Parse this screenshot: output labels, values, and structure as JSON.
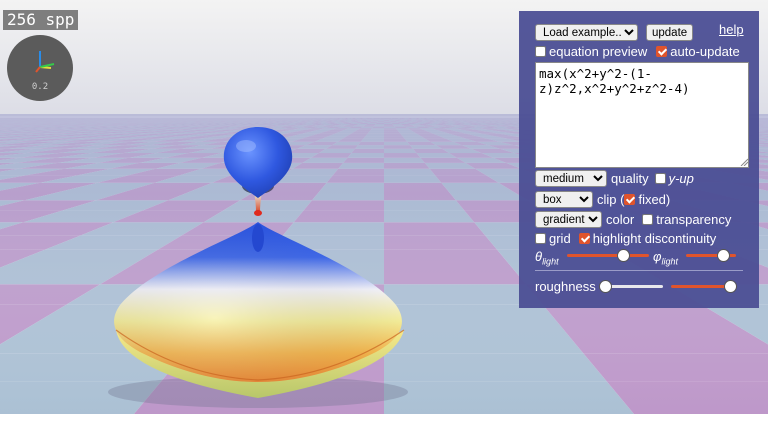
{
  "hud": {
    "spp": "256 spp",
    "gizmo_value": "0.2"
  },
  "panel": {
    "load_example": "Load example...",
    "update": "update",
    "help": "help",
    "equation_preview": "equation preview",
    "equation_preview_checked": false,
    "auto_update": "auto-update",
    "auto_update_checked": true,
    "equation": "max(x^2+y^2-(1-z)z^2,x^2+y^2+z^2-4)",
    "quality_select": "medium",
    "quality_label": "quality",
    "yup_label": "y-up",
    "yup_checked": false,
    "clip_select": "box",
    "clip_label": "clip (",
    "fixed_label": "fixed)",
    "fixed_checked": true,
    "color_select": "gradient",
    "color_label": "color",
    "transparency_label": "transparency",
    "transparency_checked": false,
    "grid_label": "grid",
    "grid_checked": false,
    "highlight_label": "highlight discontinuity",
    "highlight_checked": true,
    "theta_symbol": "θ",
    "theta_sub": "light",
    "theta_value": 0.72,
    "phi_symbol": "φ",
    "phi_sub": "light",
    "phi_value": 0.85,
    "roughness_label": "roughness",
    "roughness_value": 0.0,
    "roughness2_value": 1.0
  },
  "colors": {
    "panel_bg": "#4a4e94",
    "accent": "#e0542c"
  }
}
